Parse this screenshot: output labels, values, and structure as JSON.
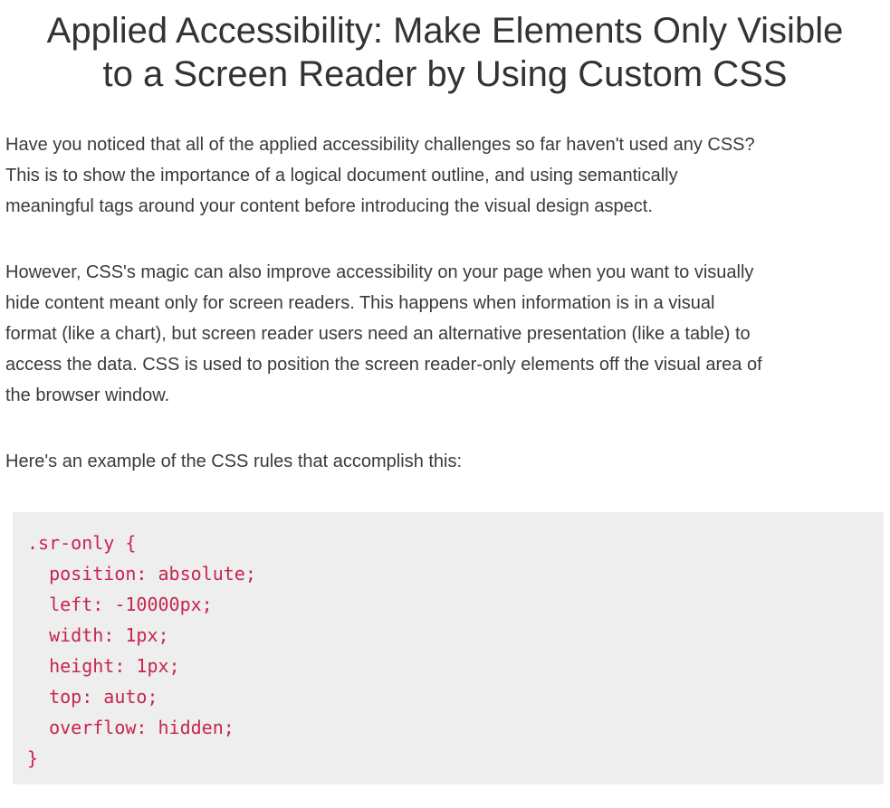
{
  "title": {
    "line1": "Applied Accessibility: Make Elements Only Visible",
    "line2": "to a Screen Reader by Using Custom CSS"
  },
  "paragraphs": {
    "p1": [
      "Have you noticed that all of the applied accessibility challenges so far haven't used any CSS?",
      "This is to show the importance of a logical document outline, and using semantically",
      "meaningful tags around your content before introducing the visual design aspect."
    ],
    "p2": [
      "However, CSS's magic can also improve accessibility on your page when you want to visually",
      "hide content meant only for screen readers. This happens when information is in a visual",
      "format (like a chart), but screen reader users need an alternative presentation (like a table) to",
      "access the data. CSS is used to position the screen reader-only elements off the visual area of",
      "the browser window."
    ],
    "p3": [
      "Here's an example of the CSS rules that accomplish this:"
    ]
  },
  "code": {
    "lines": [
      ".sr-only {",
      "  position: absolute;",
      "  left: -10000px;",
      "  width: 1px;",
      "  height: 1px;",
      "  top: auto;",
      "  overflow: hidden;",
      "}"
    ]
  },
  "colors": {
    "title_text": "#333333",
    "body_text": "#3a3a3a",
    "code_text": "#c7254e",
    "code_background": "#eeeeee"
  }
}
